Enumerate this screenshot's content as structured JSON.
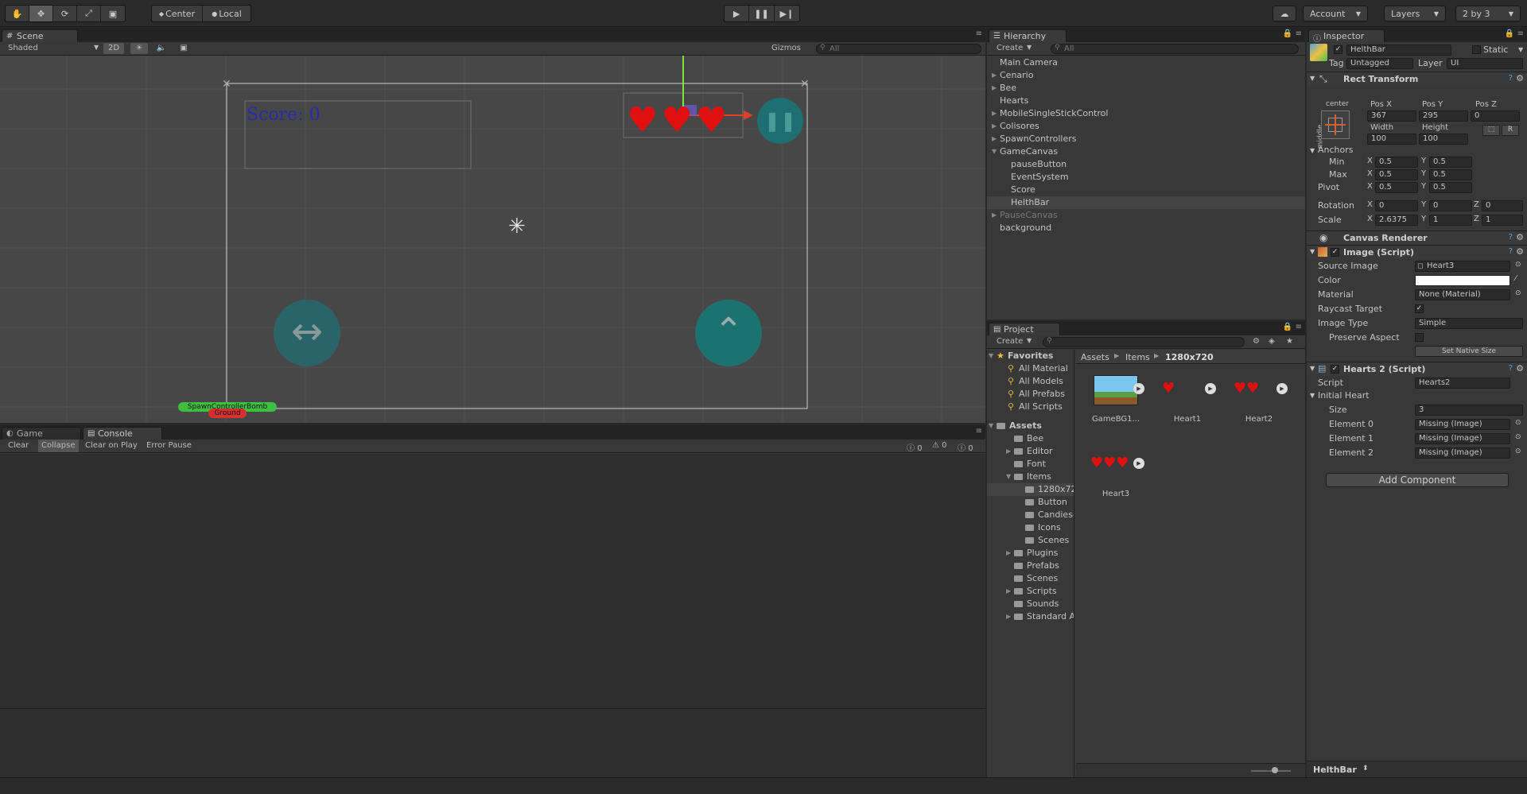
{
  "toolbar": {
    "transform_tools": [
      "hand-tool",
      "move-tool",
      "rotate-tool",
      "scale-tool",
      "rect-tool"
    ],
    "pivot_label": "Center",
    "space_label": "Local",
    "account_label": "Account",
    "layers_label": "Layers",
    "layout_label": "2 by 3"
  },
  "scene": {
    "tab_label": "Scene",
    "shading": "Shaded",
    "mode_2d": "2D",
    "gizmos_label": "Gizmos",
    "search_placeholder": "All",
    "score_text": "Score: 0",
    "spawn_label": "SpawnControllerBomb",
    "ground_label": "Ground"
  },
  "console": {
    "game_tab": "Game",
    "console_tab": "Console",
    "buttons": [
      "Clear",
      "Collapse",
      "Clear on Play",
      "Error Pause"
    ],
    "counts": {
      "info": "0",
      "warn": "0",
      "error": "0"
    }
  },
  "hierarchy": {
    "tab_label": "Hierarchy",
    "create_label": "Create",
    "search_placeholder": "All",
    "items": [
      {
        "label": "Main Camera",
        "indent": 0,
        "arrow": false,
        "selected": false,
        "muted": false
      },
      {
        "label": "Cenario",
        "indent": 0,
        "arrow": true,
        "selected": false,
        "muted": false
      },
      {
        "label": "Bee",
        "indent": 0,
        "arrow": true,
        "selected": false,
        "muted": false
      },
      {
        "label": "Hearts",
        "indent": 0,
        "arrow": false,
        "selected": false,
        "muted": false
      },
      {
        "label": "MobileSingleStickControl",
        "indent": 0,
        "arrow": true,
        "selected": false,
        "muted": false
      },
      {
        "label": "Colisores",
        "indent": 0,
        "arrow": true,
        "selected": false,
        "muted": false
      },
      {
        "label": "SpawnControllers",
        "indent": 0,
        "arrow": true,
        "selected": false,
        "muted": false
      },
      {
        "label": "GameCanvas",
        "indent": 0,
        "arrow": true,
        "open": true,
        "selected": false,
        "muted": false
      },
      {
        "label": "pauseButton",
        "indent": 1,
        "arrow": false,
        "selected": false,
        "muted": false
      },
      {
        "label": "EventSystem",
        "indent": 1,
        "arrow": false,
        "selected": false,
        "muted": false
      },
      {
        "label": "Score",
        "indent": 1,
        "arrow": false,
        "selected": false,
        "muted": false
      },
      {
        "label": "HelthBar",
        "indent": 1,
        "arrow": false,
        "selected": true,
        "muted": false
      },
      {
        "label": "PauseCanvas",
        "indent": 0,
        "arrow": true,
        "selected": false,
        "muted": true
      },
      {
        "label": "background",
        "indent": 0,
        "arrow": false,
        "selected": false,
        "muted": false
      }
    ]
  },
  "project": {
    "tab_label": "Project",
    "create_label": "Create",
    "favorites_label": "Favorites",
    "favorites": [
      "All Material",
      "All Models",
      "All Prefabs",
      "All Scripts"
    ],
    "assets_label": "Assets",
    "tree": [
      {
        "label": "Bee",
        "indent": 1,
        "arrow": false
      },
      {
        "label": "Editor",
        "indent": 1,
        "arrow": true
      },
      {
        "label": "Font",
        "indent": 1,
        "arrow": false
      },
      {
        "label": "Items",
        "indent": 1,
        "arrow": true,
        "open": true
      },
      {
        "label": "1280x72",
        "indent": 2,
        "arrow": false,
        "selected": true
      },
      {
        "label": "Button",
        "indent": 2,
        "arrow": false
      },
      {
        "label": "Candies-",
        "indent": 2,
        "arrow": false
      },
      {
        "label": "Icons",
        "indent": 2,
        "arrow": false
      },
      {
        "label": "Scenes",
        "indent": 2,
        "arrow": false
      },
      {
        "label": "Plugins",
        "indent": 1,
        "arrow": true
      },
      {
        "label": "Prefabs",
        "indent": 1,
        "arrow": false
      },
      {
        "label": "Scenes",
        "indent": 1,
        "arrow": false
      },
      {
        "label": "Scripts",
        "indent": 1,
        "arrow": true
      },
      {
        "label": "Sounds",
        "indent": 1,
        "arrow": false
      },
      {
        "label": "Standard A",
        "indent": 1,
        "arrow": true
      }
    ],
    "breadcrumb": [
      "Assets",
      "Items",
      "1280x720"
    ],
    "assets": [
      {
        "label": "GameBG1...",
        "kind": "bg"
      },
      {
        "label": "Heart1",
        "kind": "h1"
      },
      {
        "label": "Heart2",
        "kind": "h2"
      },
      {
        "label": "Heart3",
        "kind": "h3"
      }
    ]
  },
  "inspector": {
    "tab_label": "Inspector",
    "object_name": "HelthBar",
    "static_label": "Static",
    "tag_label": "Tag",
    "tag_value": "Untagged",
    "layer_label": "Layer",
    "layer_value": "UI",
    "rect_transform": {
      "title": "Rect Transform",
      "anchor_h": "center",
      "anchor_v": "middle",
      "pos_x_label": "Pos X",
      "pos_y_label": "Pos Y",
      "pos_z_label": "Pos Z",
      "pos_x": "367",
      "pos_y": "295",
      "pos_z": "0",
      "width_label": "Width",
      "height_label": "Height",
      "width": "100",
      "height": "100",
      "anchors_label": "Anchors",
      "min_label": "Min",
      "max_label": "Max",
      "pivot_label": "Pivot",
      "min_x": "0.5",
      "min_y": "0.5",
      "max_x": "0.5",
      "max_y": "0.5",
      "pivot_x": "0.5",
      "pivot_y": "0.5",
      "rotation_label": "Rotation",
      "rot_x": "0",
      "rot_y": "0",
      "rot_z": "0",
      "scale_label": "Scale",
      "scale_x": "2.6375",
      "scale_y": "1",
      "scale_z": "1",
      "x": "X",
      "y": "Y",
      "z": "Z",
      "r_button": "R"
    },
    "canvas_renderer": "Canvas Renderer",
    "image_script": {
      "title": "Image (Script)",
      "source_image_label": "Source Image",
      "source_image": "Heart3",
      "color_label": "Color",
      "material_label": "Material",
      "material": "None (Material)",
      "raycast_label": "Raycast Target",
      "image_type_label": "Image Type",
      "image_type": "Simple",
      "preserve_label": "Preserve Aspect",
      "native_size_button": "Set Native Size"
    },
    "hearts_script": {
      "title": "Hearts 2 (Script)",
      "script_label": "Script",
      "script_value": "Hearts2",
      "initial_heart_label": "Initial Heart",
      "size_label": "Size",
      "size_value": "3",
      "elements": [
        {
          "label": "Element 0",
          "value": "Missing (Image)"
        },
        {
          "label": "Element 1",
          "value": "Missing (Image)"
        },
        {
          "label": "Element 2",
          "value": "Missing (Image)"
        }
      ]
    },
    "add_component": "Add Component",
    "footer_name": "HelthBar"
  },
  "colors": {
    "background": "#282828",
    "panel": "#383838",
    "heart": "#e01010",
    "teal_button": "#1e7a7a",
    "score_text": "#2a2ab0",
    "selection": "#444444"
  }
}
